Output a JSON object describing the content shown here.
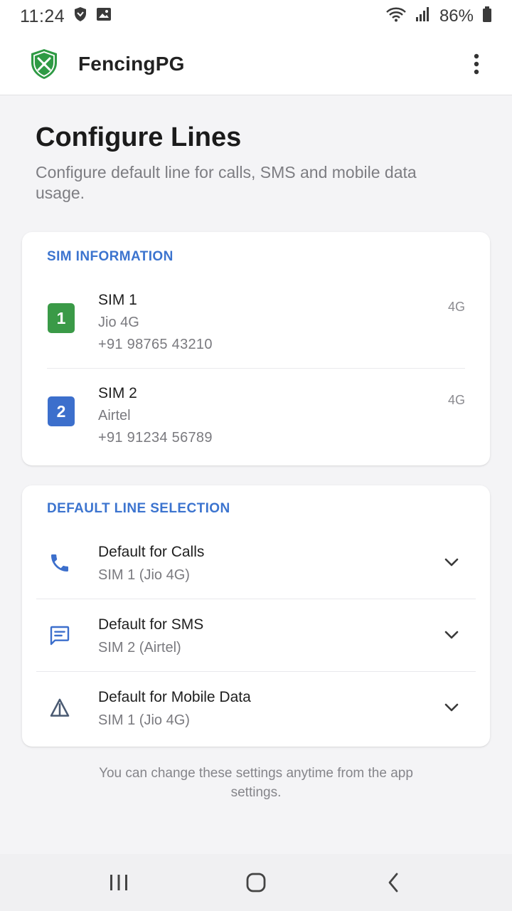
{
  "status_bar": {
    "time": "11:24",
    "battery_percent": "86%",
    "icons": [
      "shield-icon",
      "image-icon",
      "wifi-icon",
      "signal-icon",
      "battery-icon"
    ]
  },
  "app_bar": {
    "title": "FencingPG",
    "logo_icon": "shield-logo-icon",
    "menu_icon": "more-vert-icon"
  },
  "header": {
    "title": "Configure Lines",
    "subtitle": "Configure default line for calls, SMS and mobile data usage."
  },
  "sim_information": {
    "heading": "SIM INFORMATION",
    "sims": [
      {
        "badge": "1",
        "name": "SIM 1",
        "carrier": "Jio 4G",
        "number": "+91 98765 43210",
        "tech": "4G",
        "color": "#3a9a47"
      },
      {
        "badge": "2",
        "name": "SIM 2",
        "carrier": "Airtel",
        "number": "+91 91234 56789",
        "tech": "4G",
        "color": "#3c6fcc"
      }
    ]
  },
  "default_line_selection": {
    "heading": "DEFAULT LINE SELECTION",
    "items": [
      {
        "label": "Default for Calls",
        "value": "SIM 1 (Jio 4G)",
        "icon": "phone-icon"
      },
      {
        "label": "Default for SMS",
        "value": "SIM 2 (Airtel)",
        "icon": "message-icon"
      },
      {
        "label": "Default for Mobile Data",
        "value": "SIM 1 (Jio 4G)",
        "icon": "mobile-data-icon"
      }
    ]
  },
  "footer": {
    "note": "You can change these settings anytime from the app settings."
  },
  "nav_bar": {
    "buttons": [
      "recents-icon",
      "home-icon",
      "back-icon"
    ]
  },
  "colors": {
    "accent": "#3c74cf",
    "sim1": "#3a9a47",
    "sim2": "#3c6fcc",
    "logo_green": "#2e9a44"
  }
}
